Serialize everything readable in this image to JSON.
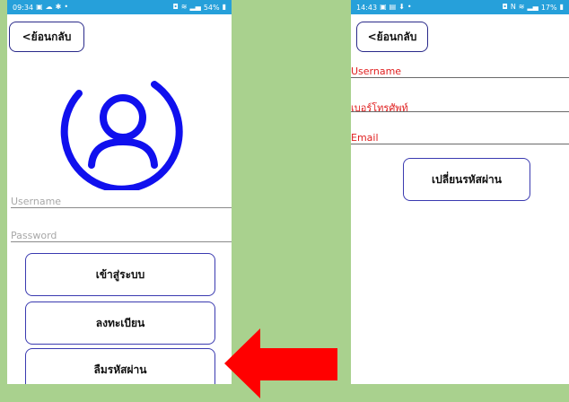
{
  "left_screen": {
    "status": {
      "time": "09:34",
      "right": "54%"
    },
    "back_label": "<ย้อนกลับ",
    "username_placeholder": "Username",
    "password_placeholder": "Password",
    "login_label": "เข้าสู่ระบบ",
    "register_label": "ลงทะเบียน",
    "forgot_label": "ลืมรหัสผ่าน"
  },
  "right_screen": {
    "status": {
      "time": "14:43",
      "right": "17%"
    },
    "back_label": "<ย้อนกลับ",
    "username_label": "Username",
    "phone_label": "เบอร์โทรศัพท์",
    "email_label": "Email",
    "change_password_label": "เปลี่ยนรหัสผ่าน"
  },
  "colors": {
    "background": "#a9d18e",
    "status_bar": "#26a0da",
    "avatar_blue": "#1010ee",
    "field_label_red": "#e02020",
    "arrow_red": "#ff0000"
  },
  "icons": [
    "user-avatar-icon",
    "arrow-left-icon"
  ]
}
